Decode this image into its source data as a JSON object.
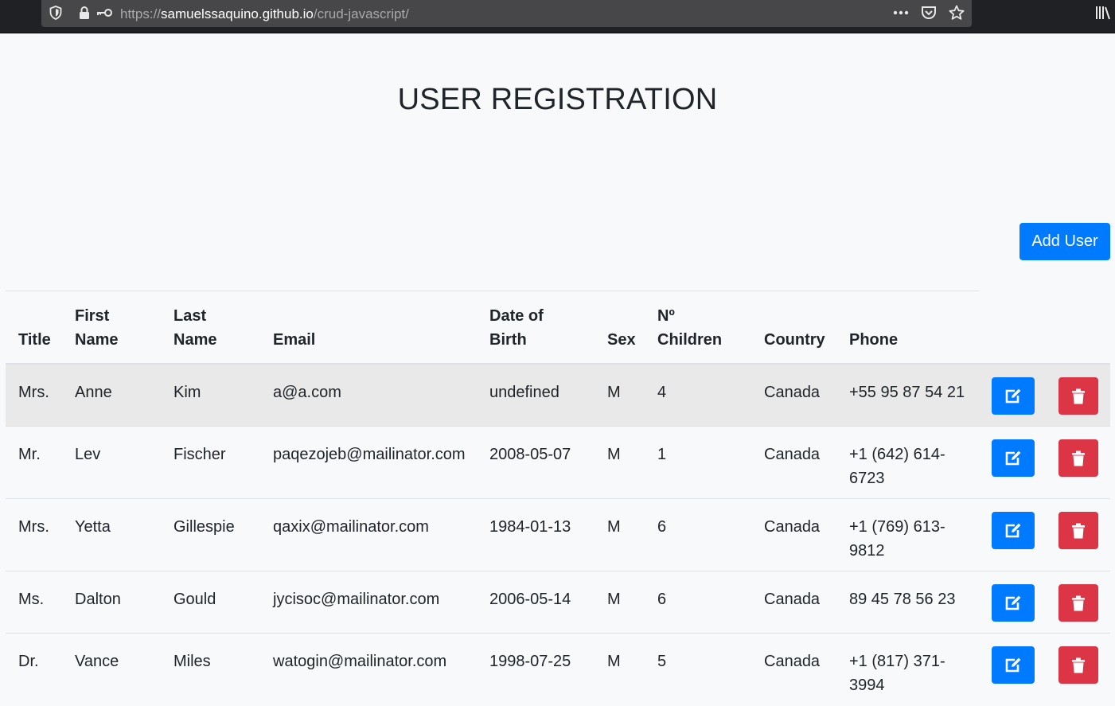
{
  "browser": {
    "url_scheme": "https://",
    "url_host": "samuelssaquino.github.io",
    "url_path": "/crud-javascript/",
    "icons": [
      "shield-icon",
      "lock-icon",
      "key-icon",
      "more-icon",
      "pocket-icon",
      "star-icon",
      "library-icon"
    ]
  },
  "page": {
    "title": "USER REGISTRATION",
    "add_user_label": "Add User"
  },
  "table": {
    "headers": {
      "title": "Title",
      "first_name": "First\nName",
      "last_name": "Last\nName",
      "email": "Email",
      "dob": "Date of\nBirth",
      "sex": "Sex",
      "children": "Nº\nChildren",
      "country": "Country",
      "phone": "Phone"
    },
    "rows": [
      {
        "title": "Mrs.",
        "first": "Anne",
        "last": "Kim",
        "email": "a@a.com",
        "dob": "undefined",
        "sex": "M",
        "children": "4",
        "country": "Canada",
        "phone": "+55 95 87 54 21"
      },
      {
        "title": "Mr.",
        "first": "Lev",
        "last": "Fischer",
        "email": "paqezojeb@mailinator.com",
        "dob": "2008-05-07",
        "sex": "M",
        "children": "1",
        "country": "Canada",
        "phone": "+1 (642) 614-6723"
      },
      {
        "title": "Mrs.",
        "first": "Yetta",
        "last": "Gillespie",
        "email": "qaxix@mailinator.com",
        "dob": "1984-01-13",
        "sex": "M",
        "children": "6",
        "country": "Canada",
        "phone": "+1 (769) 613-9812"
      },
      {
        "title": "Ms.",
        "first": "Dalton",
        "last": "Gould",
        "email": "jycisoc@mailinator.com",
        "dob": "2006-05-14",
        "sex": "M",
        "children": "6",
        "country": "Canada",
        "phone": "89 45 78 56 23"
      },
      {
        "title": "Dr.",
        "first": "Vance",
        "last": "Miles",
        "email": "watogin@mailinator.com",
        "dob": "1998-07-25",
        "sex": "M",
        "children": "5",
        "country": "Canada",
        "phone": "+1 (817) 371-3994"
      }
    ],
    "action_icons": {
      "edit": "edit-icon",
      "delete": "trash-icon"
    }
  },
  "colors": {
    "primary": "#007bff",
    "danger": "#dc3545",
    "text": "#212529",
    "row_hover": "#e9e9e9"
  }
}
